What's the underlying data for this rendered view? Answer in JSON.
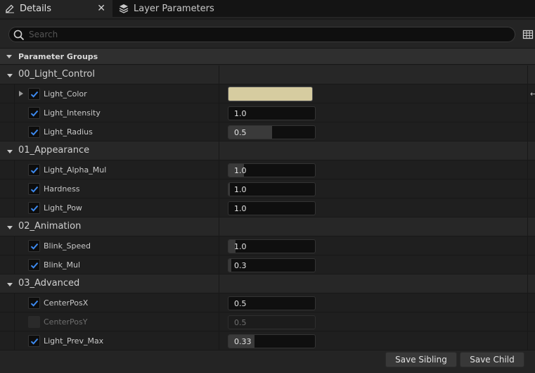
{
  "tabs": [
    {
      "label": "Details",
      "active": true,
      "icon": "pencil-icon"
    },
    {
      "label": "Layer Parameters",
      "active": false,
      "icon": "layers-icon"
    }
  ],
  "search": {
    "placeholder": "Search"
  },
  "category": {
    "label": "Parameter Groups"
  },
  "groups": [
    {
      "label": "00_Light_Control",
      "params": [
        {
          "label": "Light_Color",
          "type": "color",
          "checked": true,
          "color": "#d6cca0",
          "expandable": true
        },
        {
          "label": "Light_Intensity",
          "value": "1.0",
          "checked": true,
          "fill": 0
        },
        {
          "label": "Light_Radius",
          "value": "0.5",
          "checked": true,
          "fill": 0.5
        }
      ]
    },
    {
      "label": "01_Appearance",
      "params": [
        {
          "label": "Light_Alpha_Mul",
          "value": "1.0",
          "checked": true,
          "fill": 0.18
        },
        {
          "label": "Hardness",
          "value": "1.0",
          "checked": true,
          "fill": 0.02
        },
        {
          "label": "Light_Pow",
          "value": "1.0",
          "checked": true,
          "fill": 0
        }
      ]
    },
    {
      "label": "02_Animation",
      "params": [
        {
          "label": "Blink_Speed",
          "value": "1.0",
          "checked": true,
          "fill": 0.08
        },
        {
          "label": "Blink_Mul",
          "value": "0.3",
          "checked": true,
          "fill": 0.03
        }
      ]
    },
    {
      "label": "03_Advanced",
      "params": [
        {
          "label": "CenterPosX",
          "value": "0.5",
          "checked": true,
          "fill": 0
        },
        {
          "label": "CenterPosY",
          "value": "0.5",
          "checked": false,
          "fill": 0,
          "disabled": true
        },
        {
          "label": "Light_Prev_Max",
          "value": "0.33",
          "checked": true,
          "fill": 0.3
        }
      ]
    }
  ],
  "buttons": {
    "save_sibling": "Save Sibling",
    "save_child": "Save Child"
  },
  "colors": {
    "accent": "#3d8af0",
    "background": "#242424",
    "row": "#1f1f1f"
  }
}
